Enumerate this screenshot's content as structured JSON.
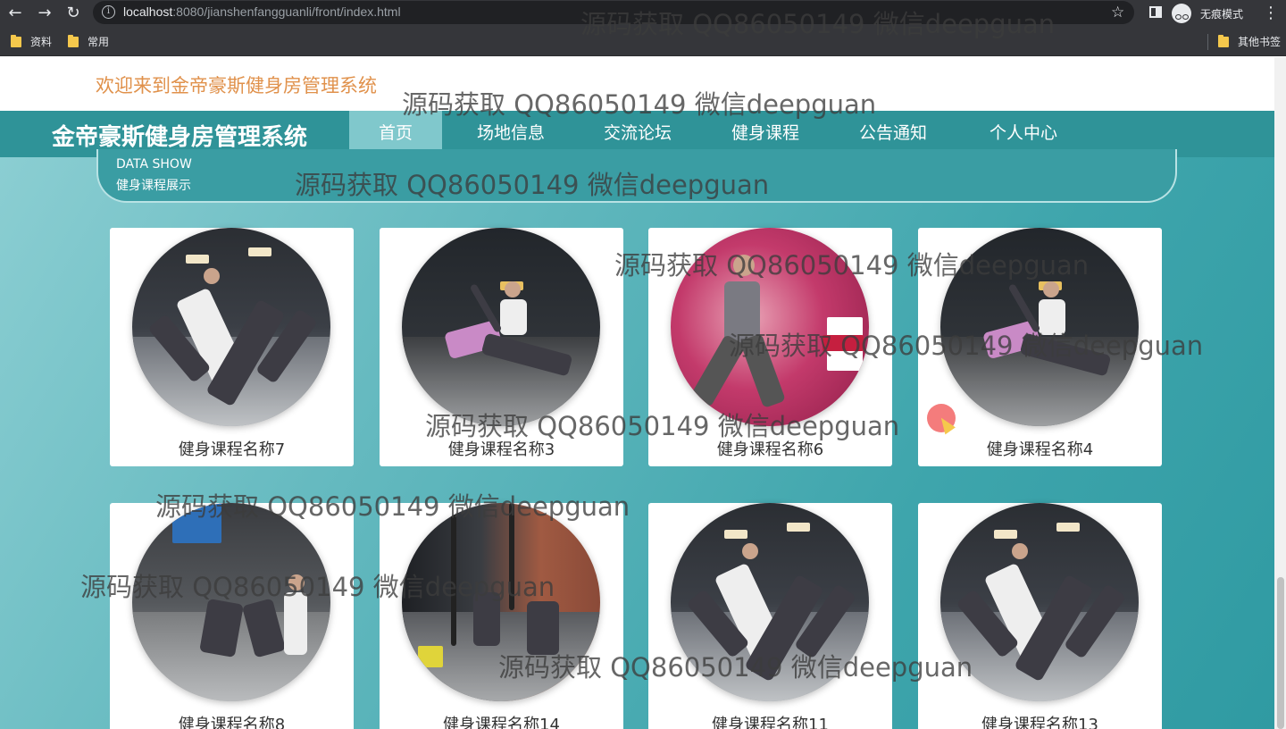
{
  "browser": {
    "url_host": "localhost",
    "url_port": ":8080",
    "url_path": "/jianshenfangguanli/front/index.html",
    "incognito_label": "无痕模式",
    "bookmarks": [
      "资料",
      "常用"
    ],
    "other_bookmarks": "其他书签"
  },
  "header": {
    "welcome": "欢迎来到金帝豪斯健身房管理系统",
    "brand": "金帝豪斯健身房管理系统"
  },
  "nav": {
    "items": [
      "首页",
      "场地信息",
      "交流论坛",
      "健身课程",
      "公告通知",
      "个人中心"
    ],
    "active": "首页"
  },
  "section": {
    "en": "DATA SHOW",
    "cn": "健身课程展示"
  },
  "courses": [
    {
      "name": "健身课程名称7"
    },
    {
      "name": "健身课程名称3"
    },
    {
      "name": "健身课程名称6"
    },
    {
      "name": "健身课程名称4"
    },
    {
      "name": "健身课程名称8"
    },
    {
      "name": "健身课程名称14"
    },
    {
      "name": "健身课程名称11"
    },
    {
      "name": "健身课程名称13"
    }
  ],
  "watermark": "源码获取 QQ86050149 微信deepguan",
  "colors": {
    "navbar": "#2f9398",
    "nav_active": "#80c8cc",
    "welcome_text": "#e0914b"
  }
}
